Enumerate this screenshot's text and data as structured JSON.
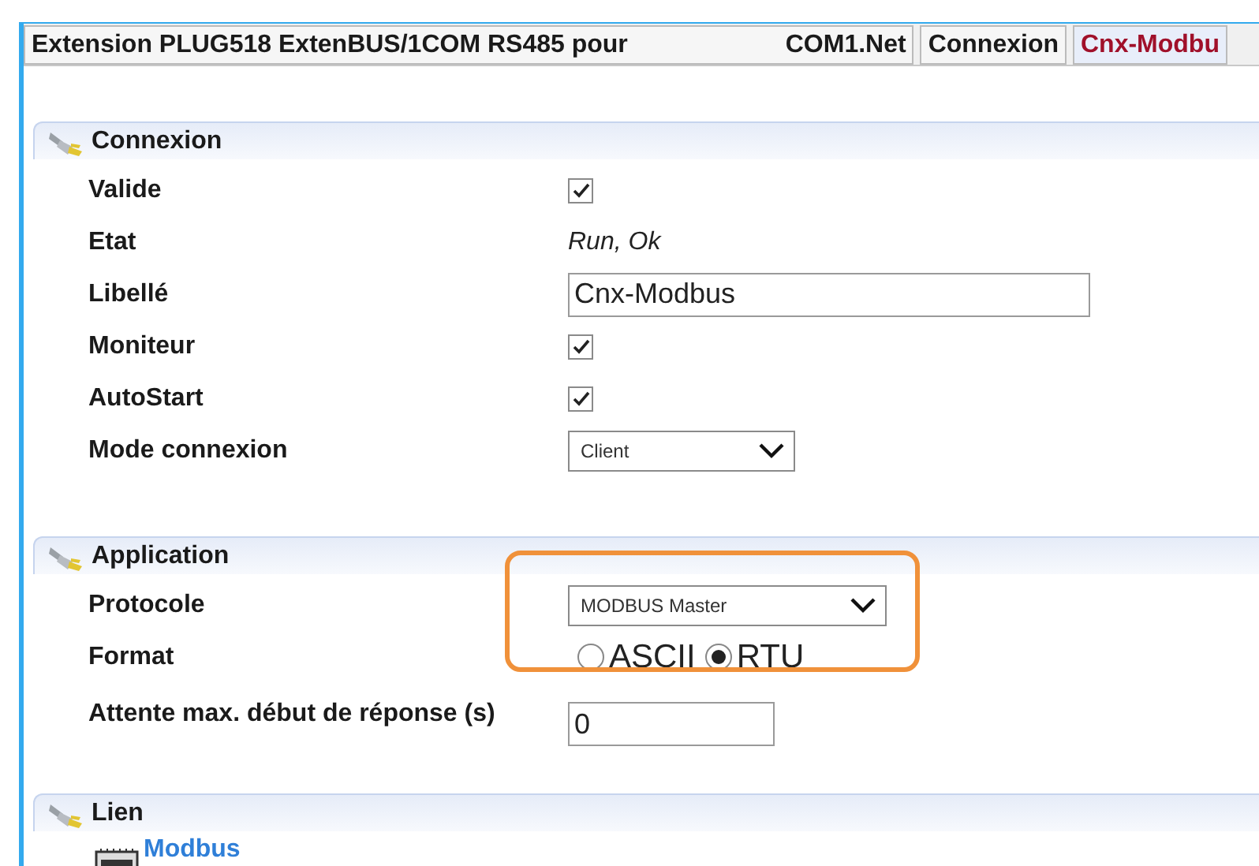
{
  "tabs": [
    {
      "label": "Extension PLUG518 ExtenBUS/1COM RS485 pour",
      "label_after": "COM1.Net",
      "selected": false
    },
    {
      "label": "Connexion",
      "selected": false
    },
    {
      "label": "Cnx-Modbu",
      "selected": true
    }
  ],
  "sections": [
    {
      "title": "Connexion",
      "fields": [
        {
          "kind": "checkbox",
          "label": "Valide",
          "checked": true
        },
        {
          "kind": "text",
          "label": "Etat",
          "value": "Run, Ok"
        },
        {
          "kind": "input",
          "label": "Libellé",
          "value": "Cnx-Modbus"
        },
        {
          "kind": "checkbox",
          "label": "Moniteur",
          "checked": true
        },
        {
          "kind": "checkbox",
          "label": "AutoStart",
          "checked": true
        },
        {
          "kind": "select",
          "label": "Mode connexion",
          "value": "Client"
        }
      ]
    },
    {
      "title": "Application",
      "fields": [
        {
          "kind": "select",
          "label": "Protocole",
          "value": "MODBUS Master"
        },
        {
          "kind": "radio",
          "label": "Format",
          "options": [
            {
              "label": "ASCII",
              "selected": false
            },
            {
              "label": "RTU",
              "selected": true
            }
          ]
        },
        {
          "kind": "input",
          "label": "Attente max. début de réponse (s)",
          "value": "0"
        }
      ]
    },
    {
      "title": "Lien",
      "links": [
        {
          "label": "Modbus"
        }
      ]
    }
  ]
}
